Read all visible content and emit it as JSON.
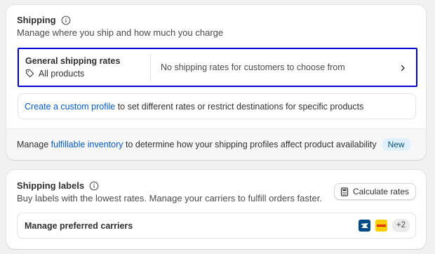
{
  "shipping": {
    "title": "Shipping",
    "subtitle": "Manage where you ship and how much you charge",
    "general_rates": {
      "heading": "General shipping rates",
      "products": "All products",
      "status": "No shipping rates for customers to choose from"
    },
    "custom_profile": {
      "link": "Create a custom profile",
      "text": " to set different rates or restrict destinations for specific products"
    },
    "footer": {
      "prefix": "Manage ",
      "link": "fulfillable inventory",
      "suffix": " to determine how your shipping profiles affect product availability",
      "badge": "New"
    }
  },
  "labels": {
    "title": "Shipping labels",
    "subtitle": "Buy labels with the lowest rates. Manage your carriers to fulfill orders faster.",
    "calculate_button": "Calculate rates",
    "carriers": {
      "label": "Manage preferred carriers",
      "logos": [
        "usps-logo",
        "dhl-logo"
      ],
      "more_count": "+2"
    }
  },
  "colors": {
    "link": "#005bd3",
    "focus_outline": "#0000cc",
    "badge_bg": "#e0f0ff",
    "usps": "#004b87",
    "dhl": "#ffcc00"
  }
}
